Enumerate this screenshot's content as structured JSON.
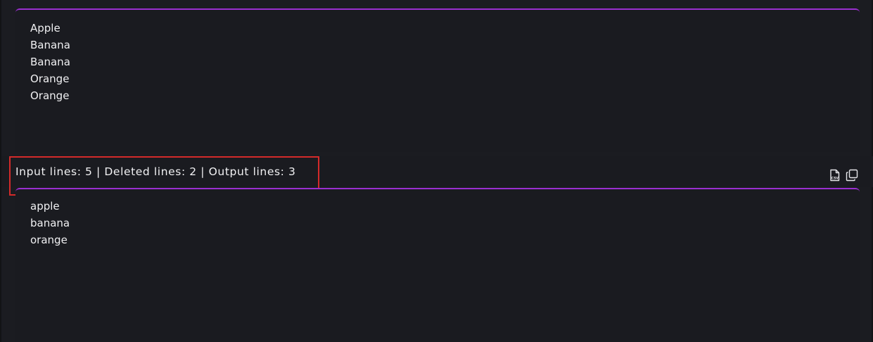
{
  "input": {
    "lines": [
      "Apple",
      "Banana",
      "Banana",
      "Orange",
      "Orange"
    ]
  },
  "stats": {
    "text": "Input lines: 5 | Deleted lines: 2 | Output lines: 3"
  },
  "output": {
    "lines": [
      "apple",
      "banana",
      "orange"
    ]
  },
  "toolbar": {
    "icons": [
      "csv-file-icon",
      "copy-icon"
    ]
  },
  "colors": {
    "background": "#1b1c21",
    "accent": "#9a2fd0",
    "highlight": "#d42a2a",
    "text": "#f0f0f2"
  }
}
